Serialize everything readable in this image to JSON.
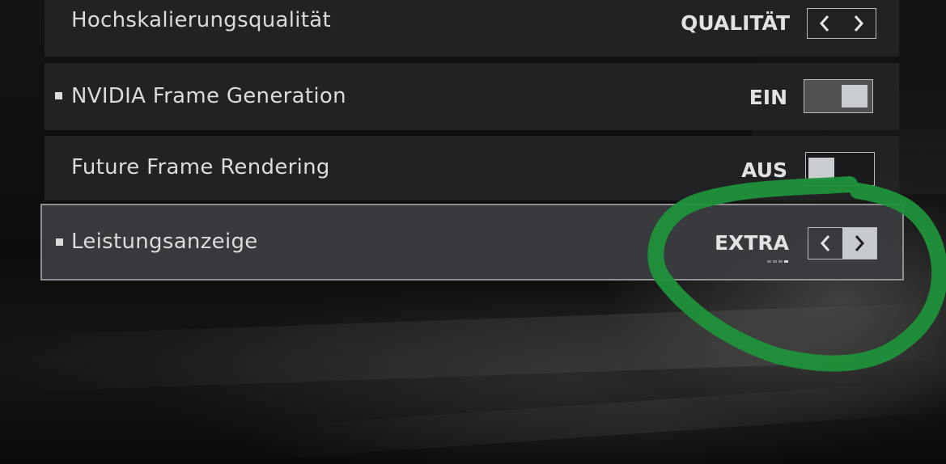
{
  "settings": [
    {
      "label": "Hochskalierungsqualität",
      "value": "QUALITÄT",
      "control": "stepper",
      "marked": false,
      "selected": false
    },
    {
      "label": "NVIDIA Frame Generation",
      "value": "EIN",
      "control": "toggle",
      "toggle_on": true,
      "marked": true,
      "selected": false
    },
    {
      "label": "Future Frame Rendering",
      "value": "AUS",
      "control": "toggle",
      "toggle_on": false,
      "marked": false,
      "selected": false
    },
    {
      "label": "Leistungsanzeige",
      "value": "EXTRA",
      "control": "stepper",
      "marked": true,
      "selected": true,
      "option_count": 4,
      "option_index": 3
    }
  ],
  "icons": {
    "prev": "chevron-left-icon",
    "next": "chevron-right-icon"
  },
  "colors": {
    "row_background": "#222325",
    "selected_row_background": "#3a3c3f",
    "selected_row_border": "#8e9093",
    "text": "#d9dbdc",
    "control_border": "#b9bcbe",
    "toggle_knob": "#c9ccd0",
    "annotation_circle": "#1f8f3a"
  }
}
